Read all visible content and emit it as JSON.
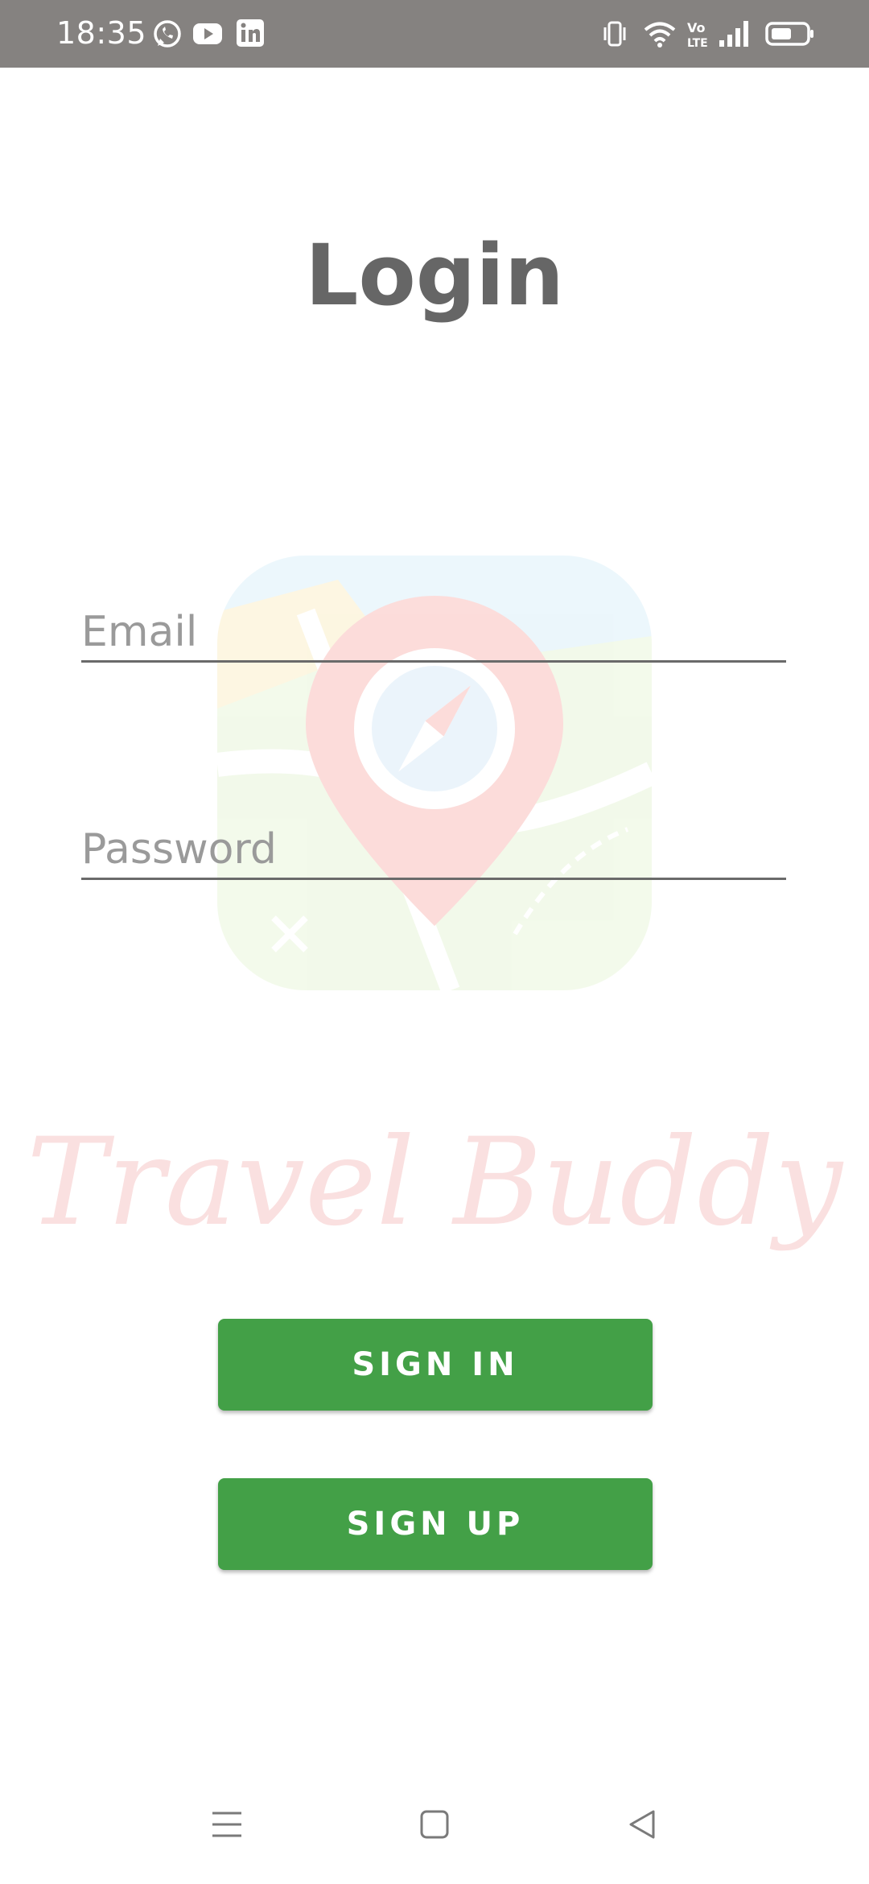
{
  "status_bar": {
    "time": "18:35",
    "app_icons": [
      "whatsapp-icon",
      "youtube-icon",
      "linkedin-icon"
    ],
    "system_icons": [
      "vibrate-icon",
      "wifi-icon",
      "volte-icon",
      "signal-icon",
      "battery-icon"
    ],
    "volte_text": "Vo LTE"
  },
  "login": {
    "title": "Login",
    "email_placeholder": "Email",
    "password_placeholder": "Password",
    "sign_in_label": "SIGN IN",
    "sign_up_label": "SIGN UP"
  },
  "branding": {
    "watermark_text": "Travel Buddy"
  },
  "nav": {
    "buttons": [
      "menu-icon",
      "home-icon",
      "back-icon"
    ]
  },
  "colors": {
    "status_bar": "#858280",
    "button": "#43a047",
    "title": "#666666",
    "watermark_text": "#f6c8c8"
  }
}
